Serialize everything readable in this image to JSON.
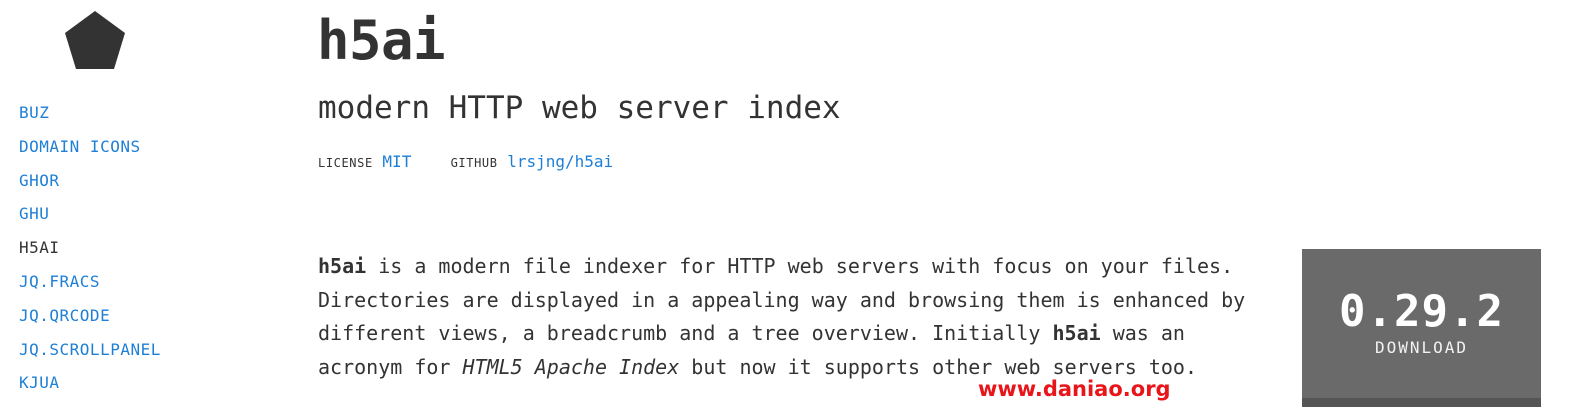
{
  "sidebar": {
    "logo_icon": "pentagon-logo-icon",
    "items": [
      {
        "label": "BUZ",
        "current": false
      },
      {
        "label": "DOMAIN ICONS",
        "current": false
      },
      {
        "label": "GHOR",
        "current": false
      },
      {
        "label": "GHU",
        "current": false
      },
      {
        "label": "H5AI",
        "current": true
      },
      {
        "label": "JQ.FRACS",
        "current": false
      },
      {
        "label": "JQ.QRCODE",
        "current": false
      },
      {
        "label": "JQ.SCROLLPANEL",
        "current": false
      },
      {
        "label": "KJUA",
        "current": false
      }
    ]
  },
  "header": {
    "title": "h5ai",
    "subtitle": "modern HTTP web server index"
  },
  "meta": {
    "license_key": "LICENSE",
    "license_value": "MIT",
    "github_key": "GITHUB",
    "github_value": "lrsjng/h5ai"
  },
  "description": {
    "p1_bold": "h5ai",
    "p1_a": " is a modern file indexer for HTTP web servers with focus on your files.",
    "p1_b": "Directories are displayed in a appealing way and browsing them is enhanced by",
    "p1_c": "different views, a breadcrumb and a tree overview. Initially ",
    "p1_bold2": "h5ai",
    "p1_d": " was an",
    "p1_e": "acronym for ",
    "p1_italic": "HTML5 Apache Index",
    "p1_f": " but now it supports other web servers too."
  },
  "download": {
    "version": "0.29.2",
    "label": "DOWNLOAD"
  },
  "watermark": "www.daniao.org",
  "colors": {
    "link": "#1e7fd6",
    "text": "#333333",
    "download_bg": "#6a6a6a",
    "watermark": "#e8161a"
  }
}
